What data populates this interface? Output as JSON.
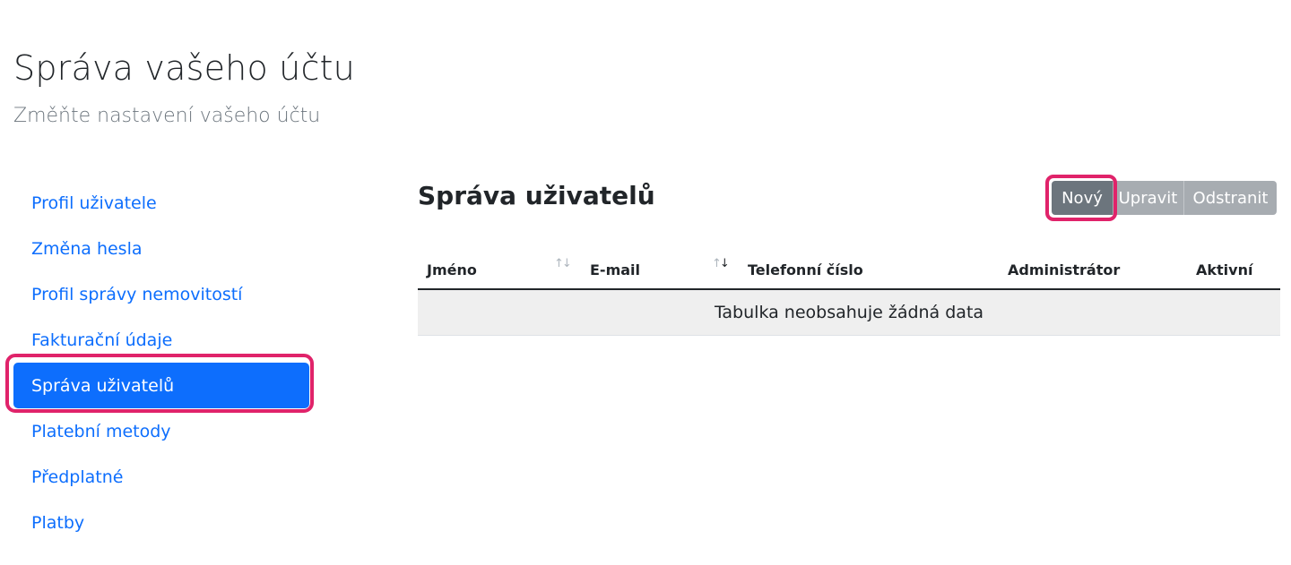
{
  "header": {
    "title": "Správa vašeho účtu",
    "subtitle": "Změňte nastavení vašeho účtu"
  },
  "sidebar": {
    "items": [
      {
        "label": "Profil uživatele"
      },
      {
        "label": "Změna hesla"
      },
      {
        "label": "Profil správy nemovitostí"
      },
      {
        "label": "Fakturační údaje"
      },
      {
        "label": "Správa uživatelů",
        "active": true
      },
      {
        "label": "Platební metody"
      },
      {
        "label": "Předplatné"
      },
      {
        "label": "Platby"
      }
    ]
  },
  "main": {
    "title": "Správa uživatelů",
    "toolbar": {
      "new_label": "Nový",
      "edit_label": "Upravit",
      "delete_label": "Odstranit"
    },
    "table": {
      "columns": [
        {
          "label": "Jméno",
          "sort_icon": "sort-both-icon"
        },
        {
          "label": "E-mail",
          "sort_icon": "sort-desc-icon"
        },
        {
          "label": "Telefonní číslo"
        },
        {
          "label": "Administrátor"
        },
        {
          "label": "Aktivní"
        }
      ],
      "empty_message": "Tabulka neobsahuje žádná data"
    }
  },
  "colors": {
    "primary": "#0d6efd",
    "secondary": "#6c757d",
    "highlight": "#e0236a"
  }
}
